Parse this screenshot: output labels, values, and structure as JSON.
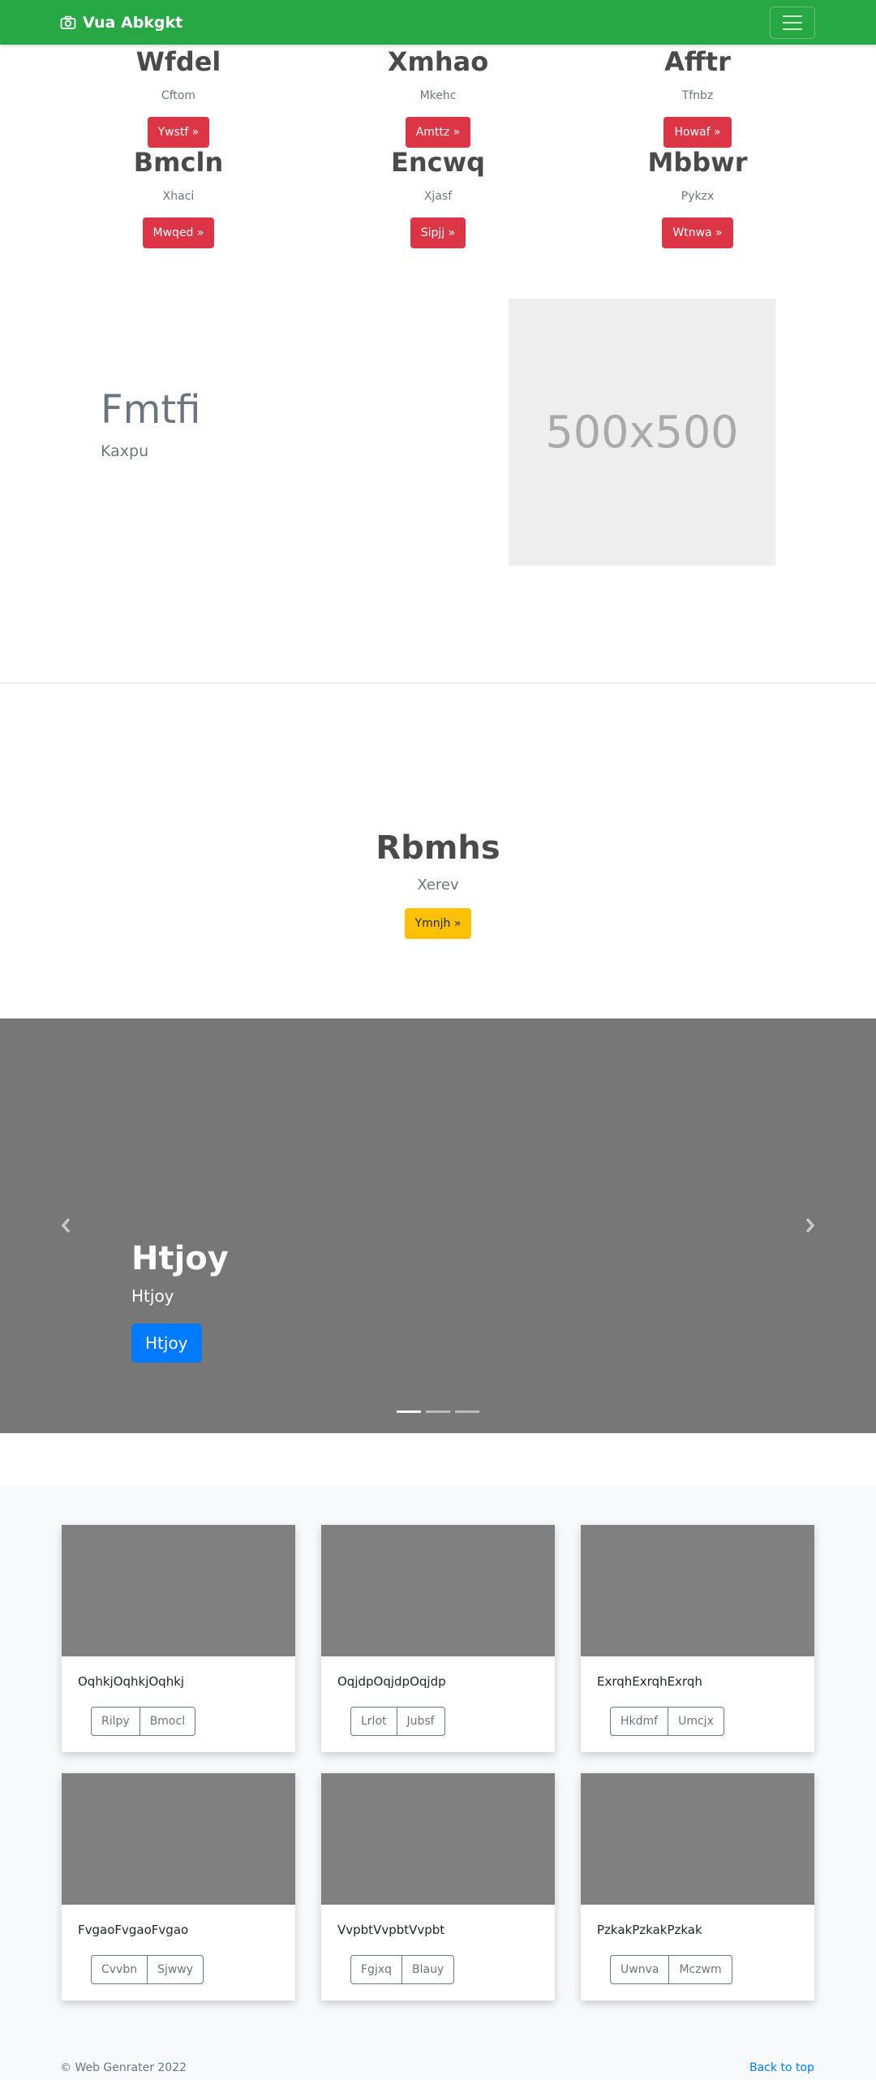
{
  "navbar": {
    "brand": "Vua Abkgkt",
    "brand_icon": "camera-icon",
    "toggler_icon": "hamburger-icon",
    "color": "#28a745"
  },
  "features": [
    {
      "title": "Wfdel",
      "subtitle": "Cftom",
      "button": "Ywstf »"
    },
    {
      "title": "Xmhao",
      "subtitle": "Mkehc",
      "button": "Amttz »"
    },
    {
      "title": "Afftr",
      "subtitle": "Tfnbz",
      "button": "Howaf »"
    },
    {
      "title": "Bmcln",
      "subtitle": "Xhaci",
      "button": "Mwqed »"
    },
    {
      "title": "Encwq",
      "subtitle": "Xjasf",
      "button": "Sipjj »"
    },
    {
      "title": "Mbbwr",
      "subtitle": "Pykzx",
      "button": "Wtnwa »"
    }
  ],
  "hero": {
    "title": "Fmtfi",
    "subtitle": "Kaxpu",
    "image_label": "500x500"
  },
  "callout": {
    "title": "Rbmhs",
    "subtitle": "Xerev",
    "button": "Ymnjh »"
  },
  "carousel": {
    "title": "Htjoy",
    "subtitle": "Htjoy",
    "button": "Htjoy",
    "prev_icon": "chevron-left-icon",
    "next_icon": "chevron-right-icon",
    "active_slide": 1,
    "slide_count": 3
  },
  "cards": [
    {
      "text": "OqhkjOqhkjOqhkj",
      "buttons": [
        "Rilpy",
        "Bmocl"
      ]
    },
    {
      "text": "OqjdpOqjdpOqjdp",
      "buttons": [
        "Lrlot",
        "Jubsf"
      ]
    },
    {
      "text": "ExrqhExrqhExrqh",
      "buttons": [
        "Hkdmf",
        "Umcjx"
      ]
    },
    {
      "text": "FvgaoFvgaoFvgao",
      "buttons": [
        "Cvvbn",
        "Sjwwy"
      ]
    },
    {
      "text": "VvpbtVvpbtVvpbt",
      "buttons": [
        "Fgjxq",
        "Blauy"
      ]
    },
    {
      "text": "PzkakPzkakPzkak",
      "buttons": [
        "Uwnva",
        "Mczwm"
      ]
    }
  ],
  "footer": {
    "copyright": "© Web Genrater 2022",
    "back_to_top": "Back to top"
  }
}
